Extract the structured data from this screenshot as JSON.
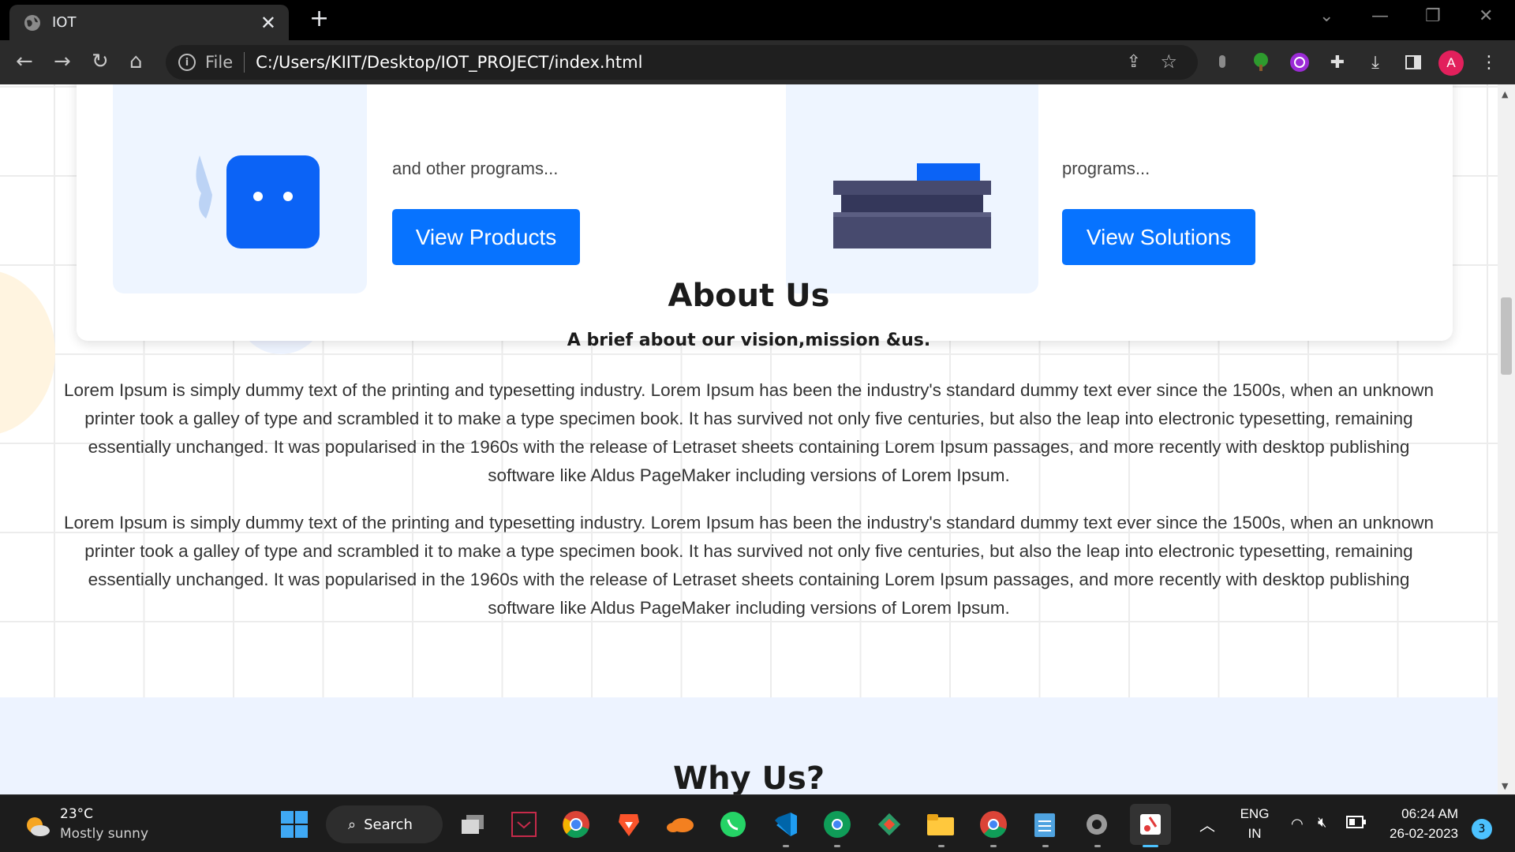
{
  "browser": {
    "tab_title": "IOT",
    "omnibox_scheme": "File",
    "url": "C:/Users/KIIT/Desktop/IOT_PROJECT/index.html",
    "profile_initial": "A"
  },
  "page": {
    "products_card": {
      "program_text": "and other programs...",
      "button_label": "View Products"
    },
    "solutions_card": {
      "program_text": "programs...",
      "button_label": "View Solutions"
    },
    "about": {
      "title": "About Us",
      "subtitle": "A brief about our vision,mission &us.",
      "paragraphs": [
        "Lorem Ipsum is simply dummy text of the printing and typesetting industry. Lorem Ipsum has been the industry's standard dummy text ever since the 1500s, when an unknown printer took a galley of type and scrambled it to make a type specimen book. It has survived not only five centuries, but also the leap into electronic typesetting, remaining essentially unchanged. It was popularised in the 1960s with the release of Letraset sheets containing Lorem Ipsum passages, and more recently with desktop publishing software like Aldus PageMaker including versions of Lorem Ipsum.",
        "Lorem Ipsum is simply dummy text of the printing and typesetting industry. Lorem Ipsum has been the industry's standard dummy text ever since the 1500s, when an unknown printer took a galley of type and scrambled it to make a type specimen book. It has survived not only five centuries, but also the leap into electronic typesetting, remaining essentially unchanged. It was popularised in the 1960s with the release of Letraset sheets containing Lorem Ipsum passages, and more recently with desktop publishing software like Aldus PageMaker including versions of Lorem Ipsum."
      ]
    },
    "why": {
      "title": "Why Us?"
    }
  },
  "taskbar": {
    "weather_temp": "23°C",
    "weather_desc": "Mostly sunny",
    "search_label": "Search",
    "language": "ENG",
    "region": "IN",
    "time": "06:24 AM",
    "date": "26-02-2023",
    "notification_count": "3"
  },
  "colors": {
    "accent_button": "#0773ff",
    "page_tint": "#edf3ff"
  }
}
